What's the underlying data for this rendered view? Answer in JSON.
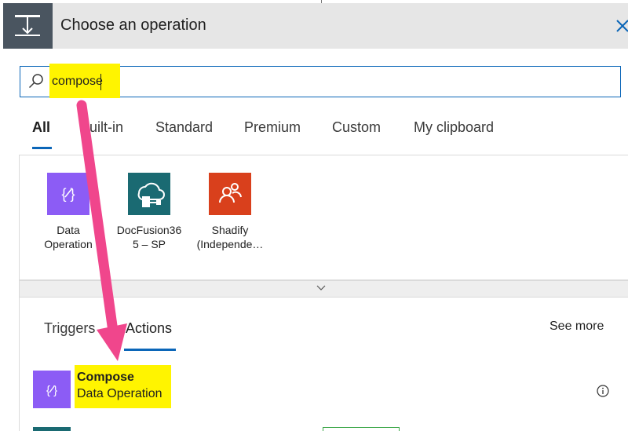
{
  "header": {
    "title": "Choose an operation",
    "icon": "compose-step-icon",
    "close_icon": "close-icon",
    "accent_color": "#4a5560"
  },
  "search": {
    "value": "compose",
    "icon": "search-icon",
    "highlight_color": "#fff400",
    "border_color": "#0b66b8"
  },
  "tabs": [
    {
      "label": "All",
      "active": true
    },
    {
      "label": "Built-in",
      "active": false
    },
    {
      "label": "Standard",
      "active": false
    },
    {
      "label": "Premium",
      "active": false
    },
    {
      "label": "Custom",
      "active": false
    },
    {
      "label": "My clipboard",
      "active": false
    }
  ],
  "connectors": [
    {
      "label_line1": "Data",
      "label_line2": "Operation",
      "icon": "data-operation-icon",
      "color": "#8c5cf5"
    },
    {
      "label_line1": "DocFusion36",
      "label_line2": "5 – SP",
      "icon": "cloud-document-icon",
      "color": "#1a6a72"
    },
    {
      "label_line1": "Shadify",
      "label_line2": "(Independe…",
      "icon": "people-icon",
      "color": "#d9401c"
    }
  ],
  "expand": {
    "icon": "chevron-down-icon"
  },
  "subtabs": [
    {
      "label": "Triggers",
      "active": false
    },
    {
      "label": "Actions",
      "active": true
    }
  ],
  "see_more": "See more",
  "actions": [
    {
      "name": "Compose",
      "connector": "Data Operation",
      "icon": "data-operation-icon",
      "color": "#8c5cf5",
      "info_icon": "info-icon"
    }
  ],
  "annotation": {
    "arrow_color": "#f0468c",
    "icon": "annotation-arrow-icon"
  }
}
